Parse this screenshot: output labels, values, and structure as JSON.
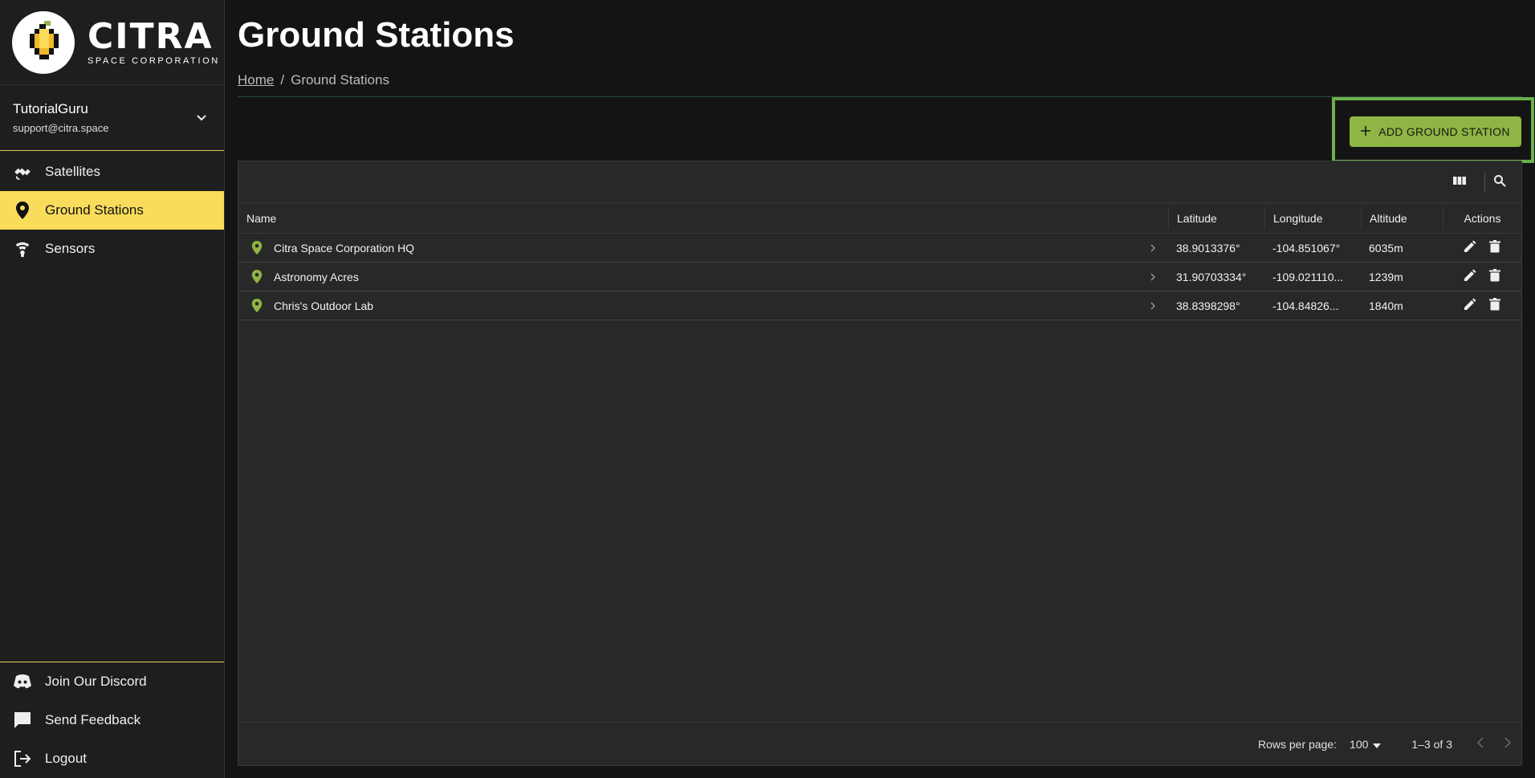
{
  "brand": {
    "name": "CITRA",
    "subtitle": "SPACE CORPORATION"
  },
  "user": {
    "name": "TutorialGuru",
    "email": "support@citra.space"
  },
  "nav": {
    "items": [
      {
        "label": "Satellites",
        "icon": "satellite-icon"
      },
      {
        "label": "Ground Stations",
        "icon": "map-pin-icon",
        "active": true
      },
      {
        "label": "Sensors",
        "icon": "sensor-icon"
      }
    ],
    "bottom": [
      {
        "label": "Join Our Discord",
        "icon": "discord-icon"
      },
      {
        "label": "Send Feedback",
        "icon": "chat-icon"
      },
      {
        "label": "Logout",
        "icon": "logout-icon"
      }
    ]
  },
  "page": {
    "title": "Ground Stations"
  },
  "breadcrumb": {
    "home": "Home",
    "separator": "/",
    "current": "Ground Stations"
  },
  "actions": {
    "add_label": "ADD GROUND STATION"
  },
  "table": {
    "columns": {
      "name": "Name",
      "latitude": "Latitude",
      "longitude": "Longitude",
      "altitude": "Altitude",
      "actions": "Actions"
    },
    "rows": [
      {
        "name": "Citra Space Corporation HQ",
        "latitude": "38.9013376°",
        "longitude": "-104.851067°",
        "altitude": "6035m"
      },
      {
        "name": "Astronomy Acres",
        "latitude": "31.90703334°",
        "longitude": "-109.021110...",
        "altitude": "1239m"
      },
      {
        "name": "Chris's Outdoor Lab",
        "latitude": "38.8398298°",
        "longitude": "-104.84826...",
        "altitude": "1840m"
      }
    ],
    "footer": {
      "rows_per_page_label": "Rows per page:",
      "rows_per_page_value": "100",
      "range": "1–3 of 3"
    }
  },
  "colors": {
    "accent": "#f9dc5c",
    "button": "#8fb544",
    "pin": "#8fb544",
    "highlight": "#6ab04c"
  }
}
